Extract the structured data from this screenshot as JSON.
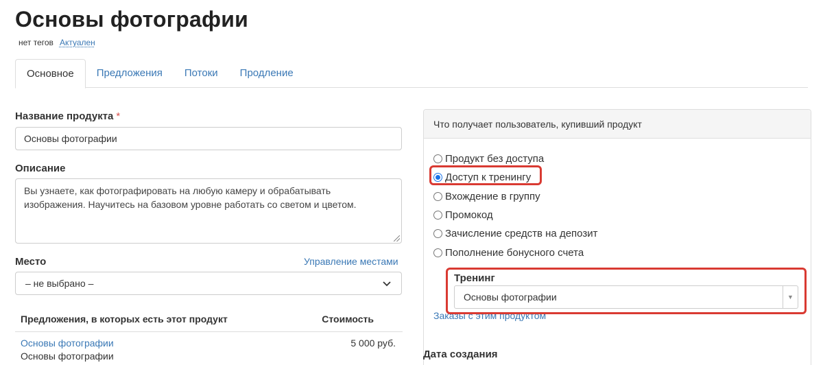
{
  "page": {
    "title": "Основы фотографии",
    "tags": "нет тегов",
    "status": "Актуален"
  },
  "tabs": [
    {
      "label": "Основное",
      "active": true
    },
    {
      "label": "Предложения",
      "active": false
    },
    {
      "label": "Потоки",
      "active": false
    },
    {
      "label": "Продление",
      "active": false
    }
  ],
  "form": {
    "name_label": "Название продукта",
    "name_required_mark": "*",
    "name_value": "Основы фотографии",
    "description_label": "Описание",
    "description_value": "Вы узнаете, как фотографировать на любую камеру и обрабатывать изображения. Научитесь на базовом уровне работать со светом и цветом.",
    "place_label": "Место",
    "place_manage_link": "Управление местами",
    "place_value": "– не выбрано –"
  },
  "offers": {
    "header_name": "Предложения, в которых есть этот продукт",
    "header_price": "Стоимость",
    "rows": [
      {
        "name": "Основы фотографии",
        "sub": "Основы фотографии",
        "price": "5 000 руб."
      }
    ]
  },
  "access_panel": {
    "header": "Что получает пользователь, купивший продукт",
    "options": [
      {
        "label": "Продукт без доступа",
        "checked": false
      },
      {
        "label": "Доступ к тренингу",
        "checked": true
      },
      {
        "label": "Вхождение в группу",
        "checked": false
      },
      {
        "label": "Промокод",
        "checked": false
      },
      {
        "label": "Зачисление средств на депозит",
        "checked": false
      },
      {
        "label": "Пополнение бонусного счета",
        "checked": false
      }
    ],
    "training_label": "Тренинг",
    "training_value": "Основы фотографии",
    "orders_link": "Заказы с этим продуктом"
  },
  "date_label": "Дата создания",
  "colors": {
    "link": "#3a78b5",
    "highlight": "#d93a32",
    "radio_checked": "#1a73e8"
  }
}
